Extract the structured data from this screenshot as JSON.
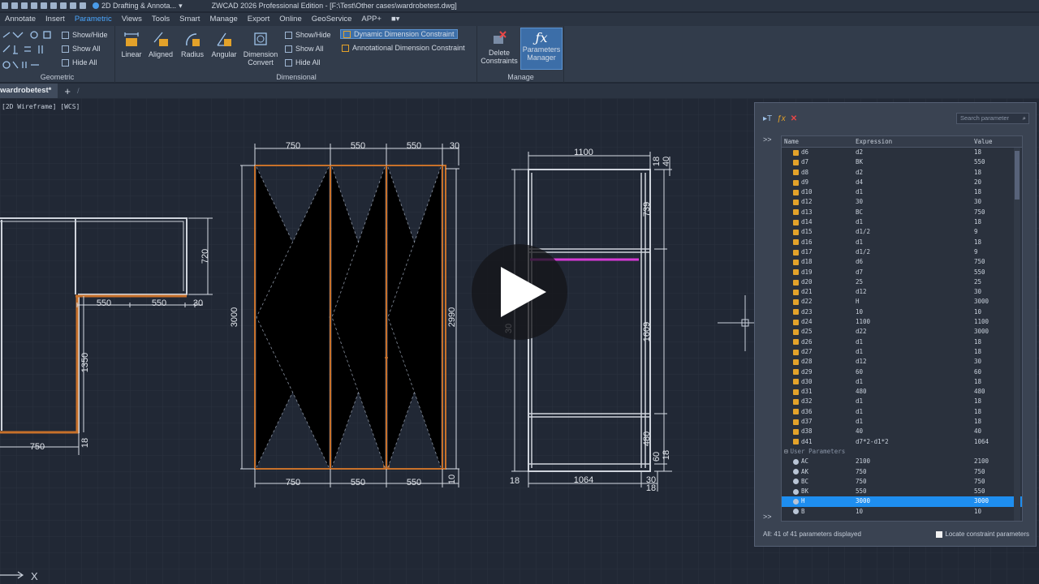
{
  "titlebar": {
    "workspace": "2D Drafting & Annota...",
    "title": "ZWCAD 2026 Professional Edition - [F:\\Test\\Other cases\\wardrobetest.dwg]"
  },
  "menu": {
    "tabs": [
      "Annotate",
      "Insert",
      "Parametric",
      "Views",
      "Tools",
      "Smart",
      "Manage",
      "Export",
      "Online",
      "GeoService",
      "APP+"
    ],
    "active": "Parametric"
  },
  "ribbon": {
    "geometric": {
      "label": "Geometric",
      "show_hide": "Show/Hide",
      "show_all": "Show All",
      "hide_all": "Hide All"
    },
    "dimensional": {
      "label": "Dimensional",
      "buttons": [
        "Linear",
        "Aligned",
        "Radius",
        "Angular",
        "Dimension Convert"
      ],
      "show_hide": "Show/Hide",
      "show_all": "Show All",
      "hide_all": "Hide All",
      "dynamic": "Dynamic Dimension Constraint",
      "annotational": "Annotational Dimension Constraint"
    },
    "manage": {
      "label": "Manage",
      "delete": "Delete Constraints",
      "params": "Parameters Manager"
    }
  },
  "doc": {
    "tab": "wardrobetest*",
    "view_label": "[2D Wireframe] [WCS]"
  },
  "palette": {
    "search_placeholder": "Search parameter",
    "headers": [
      "Name",
      "Expression",
      "Value"
    ],
    "dim_rows": [
      [
        "d6",
        "d2",
        "18"
      ],
      [
        "d7",
        "BK",
        "550"
      ],
      [
        "d8",
        "d2",
        "18"
      ],
      [
        "d9",
        "d4",
        "20"
      ],
      [
        "d10",
        "d1",
        "18"
      ],
      [
        "d12",
        "30",
        "30"
      ],
      [
        "d13",
        "BC",
        "750"
      ],
      [
        "d14",
        "d1",
        "18"
      ],
      [
        "d15",
        "d1/2",
        "9"
      ],
      [
        "d16",
        "d1",
        "18"
      ],
      [
        "d17",
        "d1/2",
        "9"
      ],
      [
        "d18",
        "d6",
        "750"
      ],
      [
        "d19",
        "d7",
        "550"
      ],
      [
        "d20",
        "25",
        "25"
      ],
      [
        "d21",
        "d12",
        "30"
      ],
      [
        "d22",
        "H",
        "3000"
      ],
      [
        "d23",
        "10",
        "10"
      ],
      [
        "d24",
        "1100",
        "1100"
      ],
      [
        "d25",
        "d22",
        "3000"
      ],
      [
        "d26",
        "d1",
        "18"
      ],
      [
        "d27",
        "d1",
        "18"
      ],
      [
        "d28",
        "d12",
        "30"
      ],
      [
        "d29",
        "60",
        "60"
      ],
      [
        "d30",
        "d1",
        "18"
      ],
      [
        "d31",
        "480",
        "480"
      ],
      [
        "d32",
        "d1",
        "18"
      ],
      [
        "d36",
        "d1",
        "18"
      ],
      [
        "d37",
        "d1",
        "18"
      ],
      [
        "d38",
        "40",
        "40"
      ],
      [
        "d41",
        "d7*2-d1*2",
        "1064"
      ]
    ],
    "user_group": "User Parameters",
    "user_rows": [
      [
        "AC",
        "2100",
        "2100"
      ],
      [
        "AK",
        "750",
        "750"
      ],
      [
        "BC",
        "750",
        "750"
      ],
      [
        "BK",
        "550",
        "550"
      ],
      [
        "H",
        "3000",
        "3000"
      ],
      [
        "B",
        "10",
        "10"
      ]
    ],
    "selected": "H",
    "footer": "All: 41 of 41 parameters displayed",
    "locate": "Locate constraint parameters"
  },
  "drawing": {
    "left_dims": [
      "720",
      "550",
      "550",
      "30",
      "1350",
      "750",
      "18"
    ],
    "mid_top": [
      "750",
      "550",
      "550",
      "30"
    ],
    "mid_bottom": [
      "750",
      "550",
      "550",
      "10"
    ],
    "mid_side": [
      "3000",
      "2990"
    ],
    "right_top": [
      "1100",
      "18",
      "40"
    ],
    "right_side": [
      "739",
      "1609",
      "480",
      "60",
      "18",
      "30"
    ],
    "right_bottom": [
      "18",
      "1064",
      "30",
      "18"
    ]
  }
}
